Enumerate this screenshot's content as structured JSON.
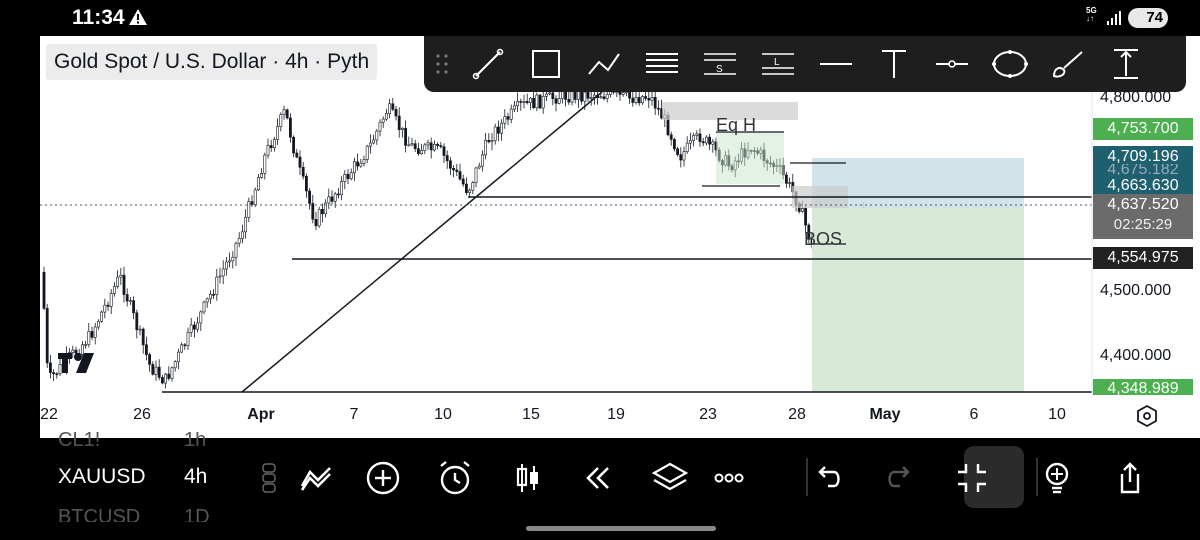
{
  "status": {
    "time": "11:34",
    "net_top": "5G",
    "net_bottom": "↓↑",
    "battery": "74"
  },
  "chart": {
    "symbol_title": "Gold Spot / U.S. Dollar · 4h · Pyth",
    "price_labels": [
      "4,800.000",
      "4,500.000",
      "4,400.000"
    ],
    "price_tags": {
      "target": "4,753.700",
      "top": "4,709.196",
      "hidden": "4,675.182",
      "entry": "4,663.630",
      "current": "4,637.520",
      "countdown": "02:25:29",
      "support": "4,554.975",
      "bottom": "4,348.989"
    },
    "date_labels": [
      "22",
      "26",
      "Apr",
      "7",
      "10",
      "15",
      "19",
      "23",
      "28",
      "May",
      "6",
      "10"
    ],
    "annotations": {
      "eq_high": "Eq H",
      "bos": "BOS"
    }
  },
  "watchlist": {
    "rows": [
      {
        "symbol": "CL1!",
        "tf": "1h"
      },
      {
        "symbol": "XAUUSD",
        "tf": "4h"
      },
      {
        "symbol": "BTCUSD",
        "tf": "1D"
      }
    ]
  },
  "colors": {
    "target_tag": "#4caf50",
    "entry_tag": "#1e6070",
    "current_tag": "#6b6b6b",
    "support_tag": "#222222",
    "profit_zone": "#d7ead8",
    "stop_zone": "#c8dfe6"
  },
  "icons": {
    "drawing_tools": [
      "trend-line",
      "rectangle",
      "path",
      "parallel-channel",
      "short-position",
      "long-position",
      "horizontal-line",
      "text",
      "horizontal-ray",
      "ellipse",
      "brush",
      "price-range"
    ],
    "bottom_bar": [
      "drawings",
      "add",
      "alert",
      "candle-type",
      "replay",
      "layers",
      "more",
      "undo",
      "redo",
      "fullscreen-exit",
      "ideas",
      "share"
    ]
  }
}
